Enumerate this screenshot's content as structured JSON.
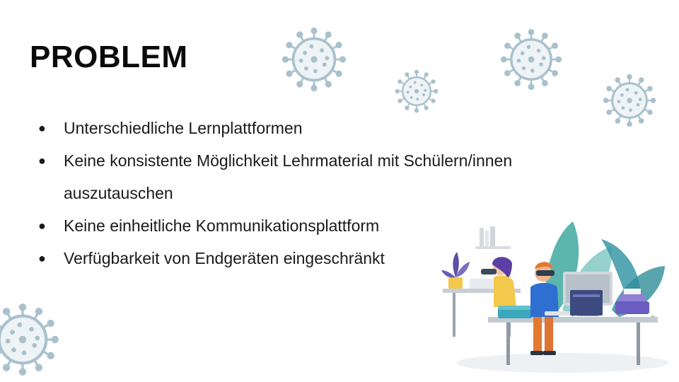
{
  "slide": {
    "title": "PROBLEM",
    "bullets": [
      {
        "marker": "●",
        "text": "Unterschiedliche Lernplattformen"
      },
      {
        "marker": "●",
        "text": "Keine konsistente Möglichkeit Lehrmaterial mit Schülern/innen auszutauschen"
      },
      {
        "marker": "●",
        "text": "Keine einheitliche Kommunikationsplattform"
      },
      {
        "marker": "●",
        "text": "Verfügbarkeit von Endgeräten eingeschränkt"
      }
    ]
  },
  "decor": {
    "virus_icon": "coronavirus-icon",
    "virus_color": "#a9c1cd",
    "illustration": "home-office-people-illustration",
    "accent_teal": "#3fa9a0",
    "accent_purple": "#5b4fa6",
    "accent_orange": "#e2792f"
  }
}
